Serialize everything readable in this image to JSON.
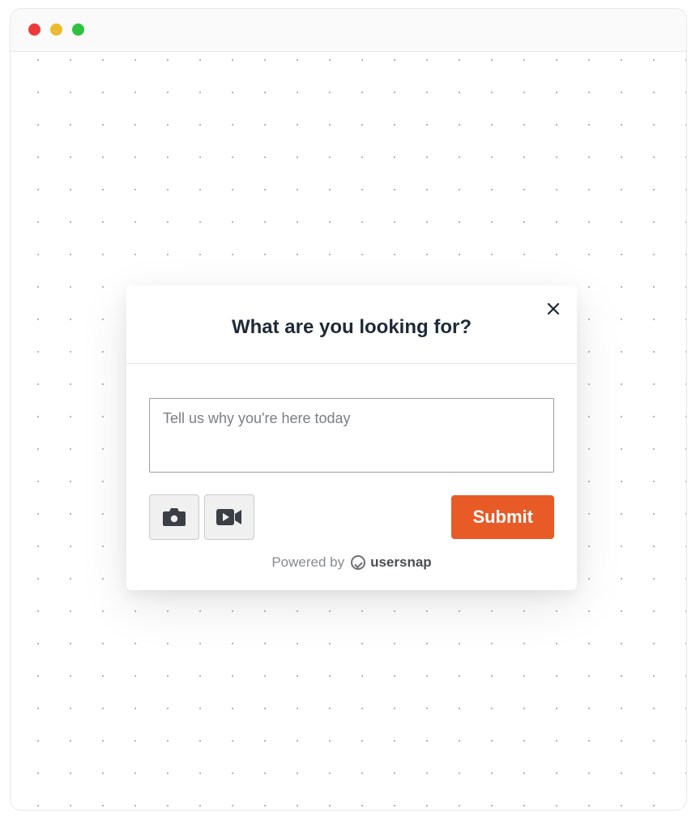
{
  "modal": {
    "title": "What are you looking for?",
    "textarea_placeholder": "Tell us why you're here today",
    "textarea_value": "",
    "submit_label": "Submit",
    "powered_by_prefix": "Powered by",
    "brand_name": "usersnap"
  },
  "colors": {
    "accent": "#e85b27"
  }
}
